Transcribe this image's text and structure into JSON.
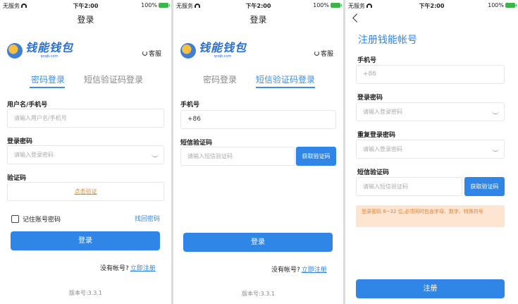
{
  "status": {
    "carrier": "无服务",
    "time": "下午2:00",
    "battery": "100%"
  },
  "logo": {
    "name": "钱能钱包",
    "domain": "qnqb.com"
  },
  "service_label": "客服",
  "login_screen": {
    "title": "登录",
    "tabs": [
      "密码登录",
      "短信验证码登录"
    ],
    "username_label": "用户名/手机号",
    "username_placeholder": "请输入用户名/手机号",
    "password_label": "登录密码",
    "password_placeholder": "请输入登录密码",
    "captcha_label": "验证码",
    "captcha_link": "点击验证",
    "remember_label": "记住账号密码",
    "forgot_link": "找回密码",
    "login_button": "登录",
    "no_account": "没有帐号?",
    "register_link": "立即注册",
    "version": "版本号:3.3.1"
  },
  "sms_screen": {
    "title": "登录",
    "tabs": [
      "密码登录",
      "短信验证码登录"
    ],
    "phone_label": "手机号",
    "phone_value": "+86",
    "sms_label": "短信验证码",
    "sms_placeholder": "请输入短信验证码",
    "get_code_button": "获取验证码",
    "login_button": "登录",
    "no_account": "没有帐号?",
    "register_link": "立即注册",
    "version": "版本号:3.3.1"
  },
  "register_screen": {
    "heading": "注册钱能帐号",
    "phone_label": "手机号",
    "phone_value": "+86",
    "password_label": "登录密码",
    "password_placeholder": "请输入登录密码",
    "repeat_label": "重复登录密码",
    "repeat_placeholder": "请输入登录密码",
    "sms_label": "短信验证码",
    "sms_placeholder": "请输入短信验证码",
    "get_code_button": "获取验证码",
    "notice": "登录密码 8~32 位,必须同时包含字母、数字、特殊符号",
    "register_button": "注册"
  }
}
